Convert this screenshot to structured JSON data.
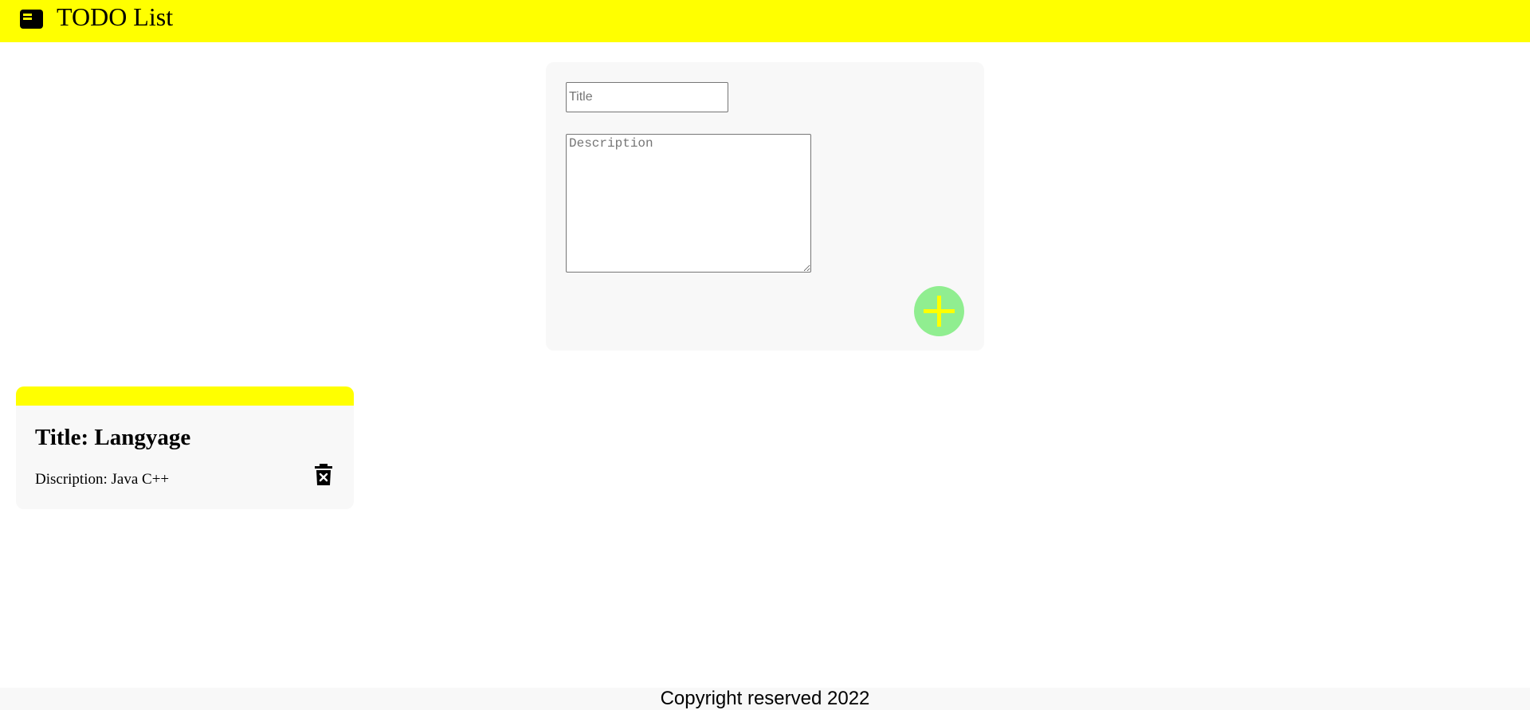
{
  "header": {
    "app_title": "TODO List",
    "logo_icon": "note-icon",
    "background_color": "#ffff00"
  },
  "form": {
    "title_placeholder": "Title",
    "title_value": "",
    "description_placeholder": "Description",
    "description_value": "",
    "add_button_icon": "plus-icon",
    "add_button_color": "#90ee90",
    "add_icon_color": "#ffff00"
  },
  "todos": [
    {
      "title": "Title: Langyage",
      "description": "Discription: Java C++",
      "delete_icon": "trash-icon"
    }
  ],
  "footer": {
    "text": "Copyright reserved 2022"
  }
}
